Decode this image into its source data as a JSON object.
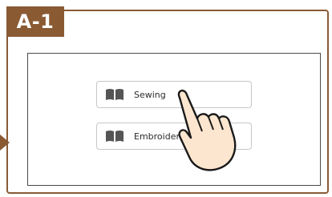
{
  "step_label": "A-1",
  "menu": {
    "items": [
      {
        "label": "Sewing",
        "icon": "book-icon"
      },
      {
        "label": "Embroidery",
        "icon": "book-icon"
      }
    ]
  },
  "colors": {
    "accent": "#8a5a33",
    "icon": "#555555",
    "hand_fill": "#fde6cf"
  }
}
